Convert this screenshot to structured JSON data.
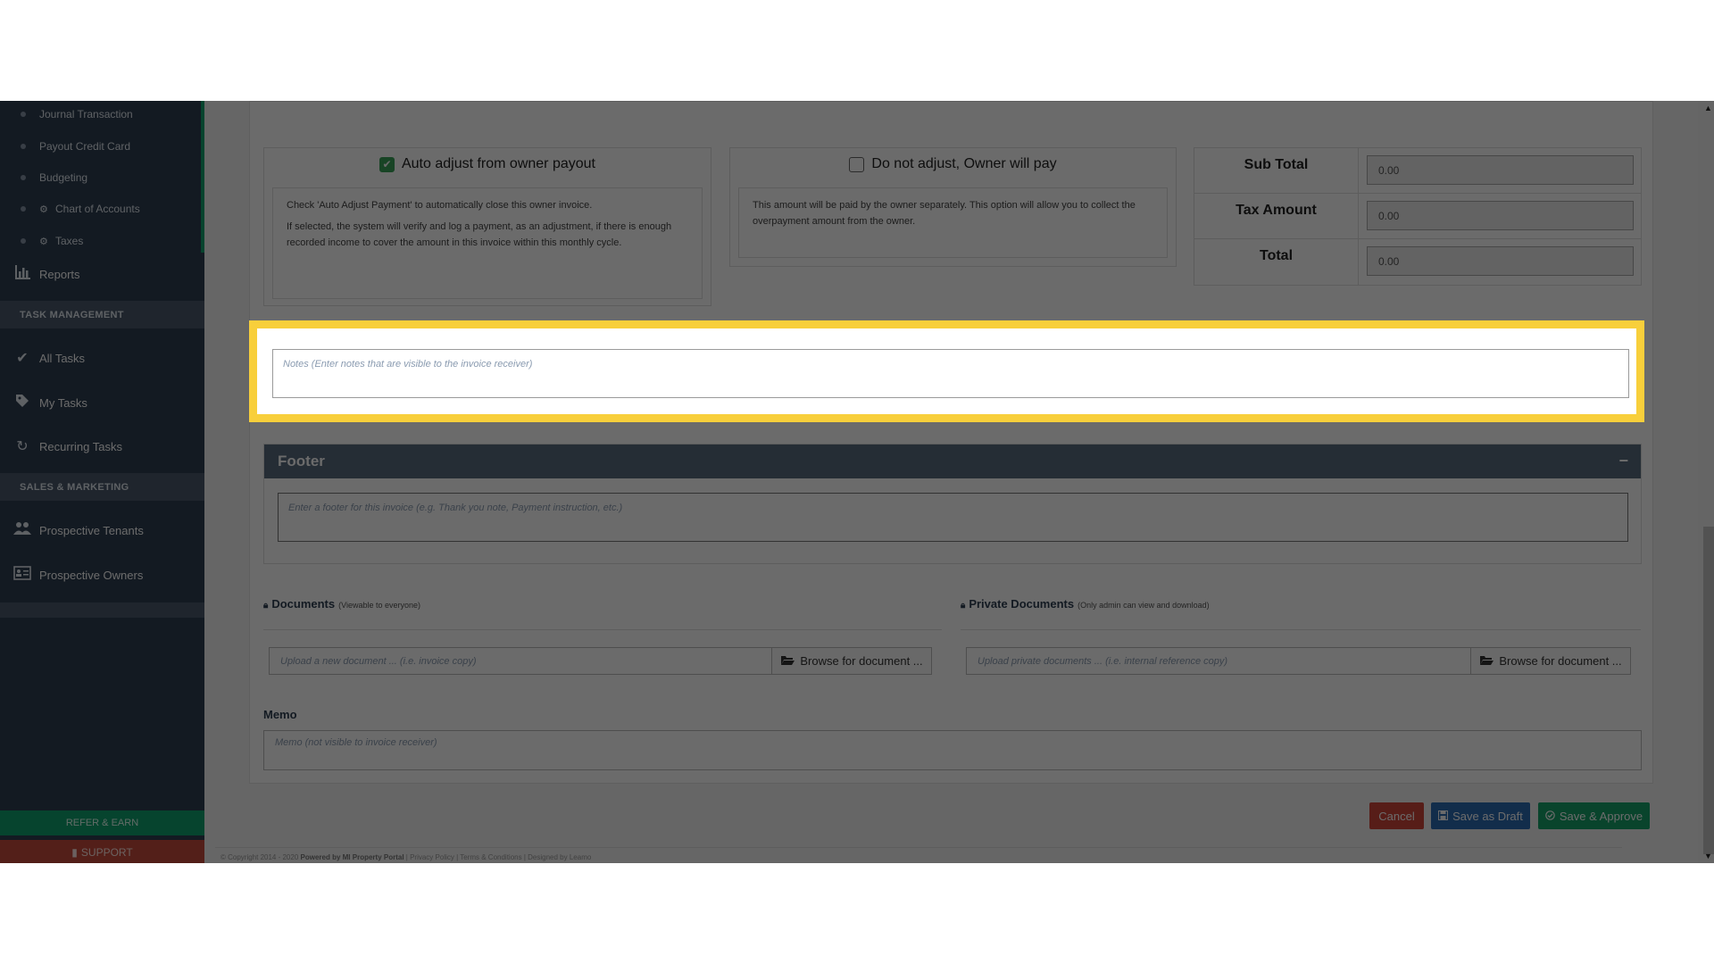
{
  "sidebar": {
    "sub_items": [
      {
        "label": "Journal Transaction",
        "icon": "bullet"
      },
      {
        "label": "Payout Credit Card",
        "icon": "bullet"
      },
      {
        "label": "Budgeting",
        "icon": "bullet"
      },
      {
        "label": "Chart of Accounts",
        "icon": "gear-icon"
      },
      {
        "label": "Taxes",
        "icon": "gear-icon"
      }
    ],
    "reports": {
      "label": "Reports",
      "icon": "bar-chart-icon"
    },
    "task_management_header": "TASK MANAGEMENT",
    "task_items": [
      {
        "label": "All Tasks",
        "icon": "check-icon"
      },
      {
        "label": "My Tasks",
        "icon": "tag-icon"
      },
      {
        "label": "Recurring Tasks",
        "icon": "refresh-icon"
      }
    ],
    "sales_marketing_header": "SALES & MARKETING",
    "sales_items": [
      {
        "label": "Prospective Tenants",
        "icon": "users-icon"
      },
      {
        "label": "Prospective Owners",
        "icon": "id-card-icon"
      }
    ],
    "refer_label": "REFER & EARN",
    "support_label": "SUPPORT"
  },
  "payment_options": {
    "auto_adjust": {
      "title": "Auto adjust from owner payout",
      "checked": true,
      "desc_1": "Check 'Auto Adjust Payment' to automatically close this owner invoice.",
      "desc_2": "If selected, the system will verify and log a payment, as an adjustment, if there is enough recorded income to cover the amount in this invoice within this monthly cycle."
    },
    "no_adjust": {
      "title": "Do not adjust, Owner will pay",
      "checked": false,
      "desc": "This amount will be paid by the owner separately. This option will allow you to collect the overpayment amount from the owner."
    }
  },
  "totals": {
    "sub_total_label": "Sub Total",
    "sub_total_value": "0.00",
    "tax_amount_label": "Tax Amount",
    "tax_amount_value": "0.00",
    "total_label": "Total",
    "total_value": "0.00"
  },
  "notes": {
    "placeholder": "Notes (Enter notes that are visible to the invoice receiver)"
  },
  "footer": {
    "title": "Footer",
    "collapse_symbol": "−",
    "placeholder": "Enter a footer for this invoice (e.g. Thank you note, Payment instruction, etc.)"
  },
  "documents": {
    "title": "Documents",
    "subtitle": "(Viewable to everyone)",
    "placeholder": "Upload a new document ... (i.e. invoice copy)",
    "browse_label": "Browse for document ..."
  },
  "private_documents": {
    "title": "Private Documents",
    "subtitle": "(Only admin can view and download)",
    "placeholder": "Upload private documents ... (i.e. internal reference copy)",
    "browse_label": "Browse for document ..."
  },
  "memo": {
    "label": "Memo",
    "placeholder": "Memo (not visible to invoice receiver)"
  },
  "actions": {
    "cancel_label": "Cancel",
    "draft_label": "Save as Draft",
    "approve_label": "Save & Approve"
  },
  "colors": {
    "sidebar_bg": "#2e3e52",
    "accent_green": "#0fa36e",
    "highlight_yellow": "#f8cf3b",
    "cancel_red": "#d0453b",
    "draft_blue": "#2d6cb4",
    "approve_green": "#16a26a"
  },
  "copyright": {
    "text": "© Copyright 2014 - 2020",
    "powered": "Powered by MI Property Portal",
    "links": "| Privacy Policy | Terms & Conditions",
    "suffix": "| Designed by Leamo"
  }
}
